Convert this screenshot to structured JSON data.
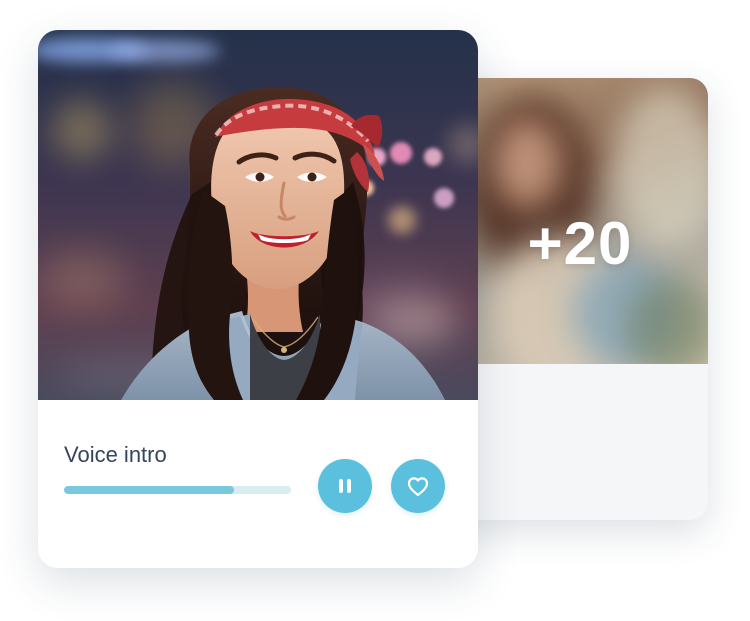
{
  "stack": {
    "back_card": {
      "count_text": "+20"
    },
    "front_card": {
      "voice_intro_label": "Voice intro",
      "progress": 0.75,
      "icons": {
        "pause": "pause-icon",
        "like": "heart-icon"
      }
    }
  },
  "colors": {
    "accent": "#5bc0de",
    "text": "#34455c",
    "progress_fill": "#79c8de",
    "progress_track": "#d7edf2"
  }
}
